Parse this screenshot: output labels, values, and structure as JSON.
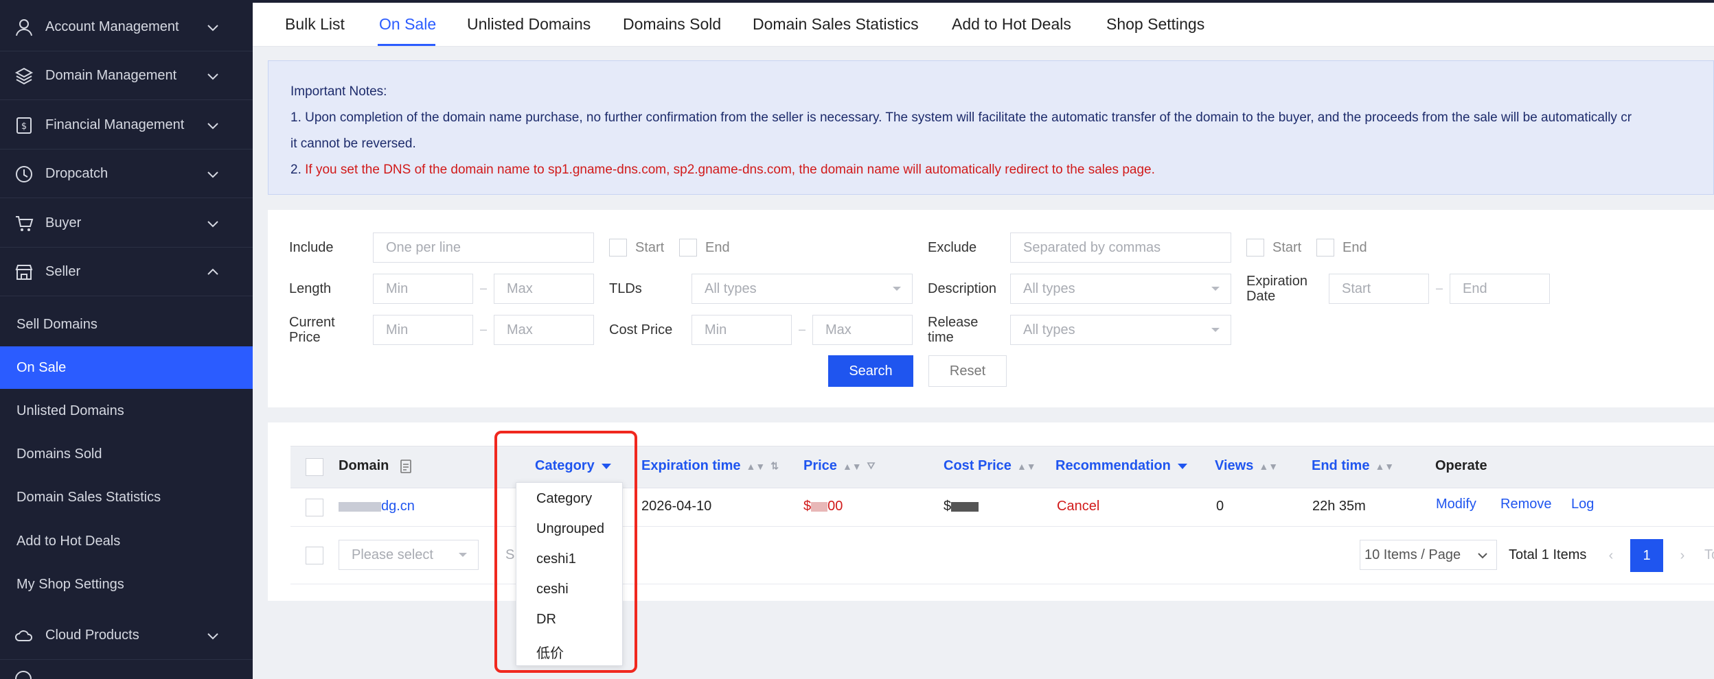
{
  "sidebar": {
    "groups": [
      {
        "label": "Account Management"
      },
      {
        "label": "Domain Management"
      },
      {
        "label": "Financial Management"
      },
      {
        "label": "Dropcatch"
      },
      {
        "label": "Buyer"
      },
      {
        "label": "Seller"
      },
      {
        "label": "Cloud Products"
      }
    ],
    "seller_items": [
      {
        "label": "Sell Domains"
      },
      {
        "label": "On Sale"
      },
      {
        "label": "Unlisted Domains"
      },
      {
        "label": "Domains Sold"
      },
      {
        "label": "Domain Sales Statistics"
      },
      {
        "label": "Add to Hot Deals"
      },
      {
        "label": "My Shop Settings"
      }
    ]
  },
  "tabs": [
    {
      "label": "Bulk List"
    },
    {
      "label": "On Sale"
    },
    {
      "label": "Unlisted Domains"
    },
    {
      "label": "Domains Sold"
    },
    {
      "label": "Domain Sales Statistics"
    },
    {
      "label": "Add to Hot Deals"
    },
    {
      "label": "Shop Settings"
    }
  ],
  "notice": {
    "title": "Important Notes:",
    "line1": "1. Upon completion of the domain name purchase, no further confirmation from the seller is necessary. The system will facilitate the automatic transfer of the domain to the buyer, and the proceeds from the sale will be automatically cr",
    "line1b": "it cannot be reversed.",
    "line2_num": "2.",
    "line2": "If you set the DNS of the domain name to sp1.gname-dns.com, sp2.gname-dns.com, the domain name will automatically redirect to the sales page."
  },
  "filters": {
    "include_label": "Include",
    "include_placeholder": "One per line",
    "start_label": "Start",
    "end_label": "End",
    "exclude_label": "Exclude",
    "exclude_placeholder": "Separated by commas",
    "length_label": "Length",
    "min_placeholder": "Min",
    "max_placeholder": "Max",
    "tlds_label": "TLDs",
    "all_types": "All types",
    "description_label": "Description",
    "expiration_label_1": "Expiration",
    "expiration_label_2": "Date",
    "start_placeholder": "Start",
    "end_placeholder": "End",
    "current_price_label_1": "Current",
    "current_price_label_2": "Price",
    "cost_price_label": "Cost Price",
    "release_label_1": "Release",
    "release_label_2": "time",
    "search_button": "Search",
    "reset_button": "Reset"
  },
  "table": {
    "headers": {
      "domain": "Domain",
      "category": "Category",
      "expiration": "Expiration time",
      "price": "Price",
      "cost_price": "Cost Price",
      "recommendation": "Recommendation",
      "views": "Views",
      "end_time": "End time",
      "operate": "Operate"
    },
    "row": {
      "domain_suffix": "dg.cn",
      "expiration": "2026-04-10",
      "price_prefix": "$",
      "price_suffix": "00",
      "cost_prefix": "$",
      "recommendation": "Cancel",
      "views": "0",
      "end_time": "22h 35m",
      "modify": "Modify",
      "remove": "Remove",
      "log": "Log"
    },
    "footer": {
      "select_placeholder": "Please select",
      "partial_text": "S",
      "page_size": "10 Items / Page",
      "total": "Total 1 Items",
      "current_page": "1",
      "goto_partial": "To"
    }
  },
  "category_dropdown": {
    "options": [
      "Category",
      "Ungrouped",
      "ceshi1",
      "ceshi",
      "DR",
      "低价"
    ]
  },
  "colors": {
    "accent": "#1f55ef",
    "sidebar_bg": "#1c2033",
    "highlight": "#f0281f",
    "danger": "#d11a1a"
  }
}
